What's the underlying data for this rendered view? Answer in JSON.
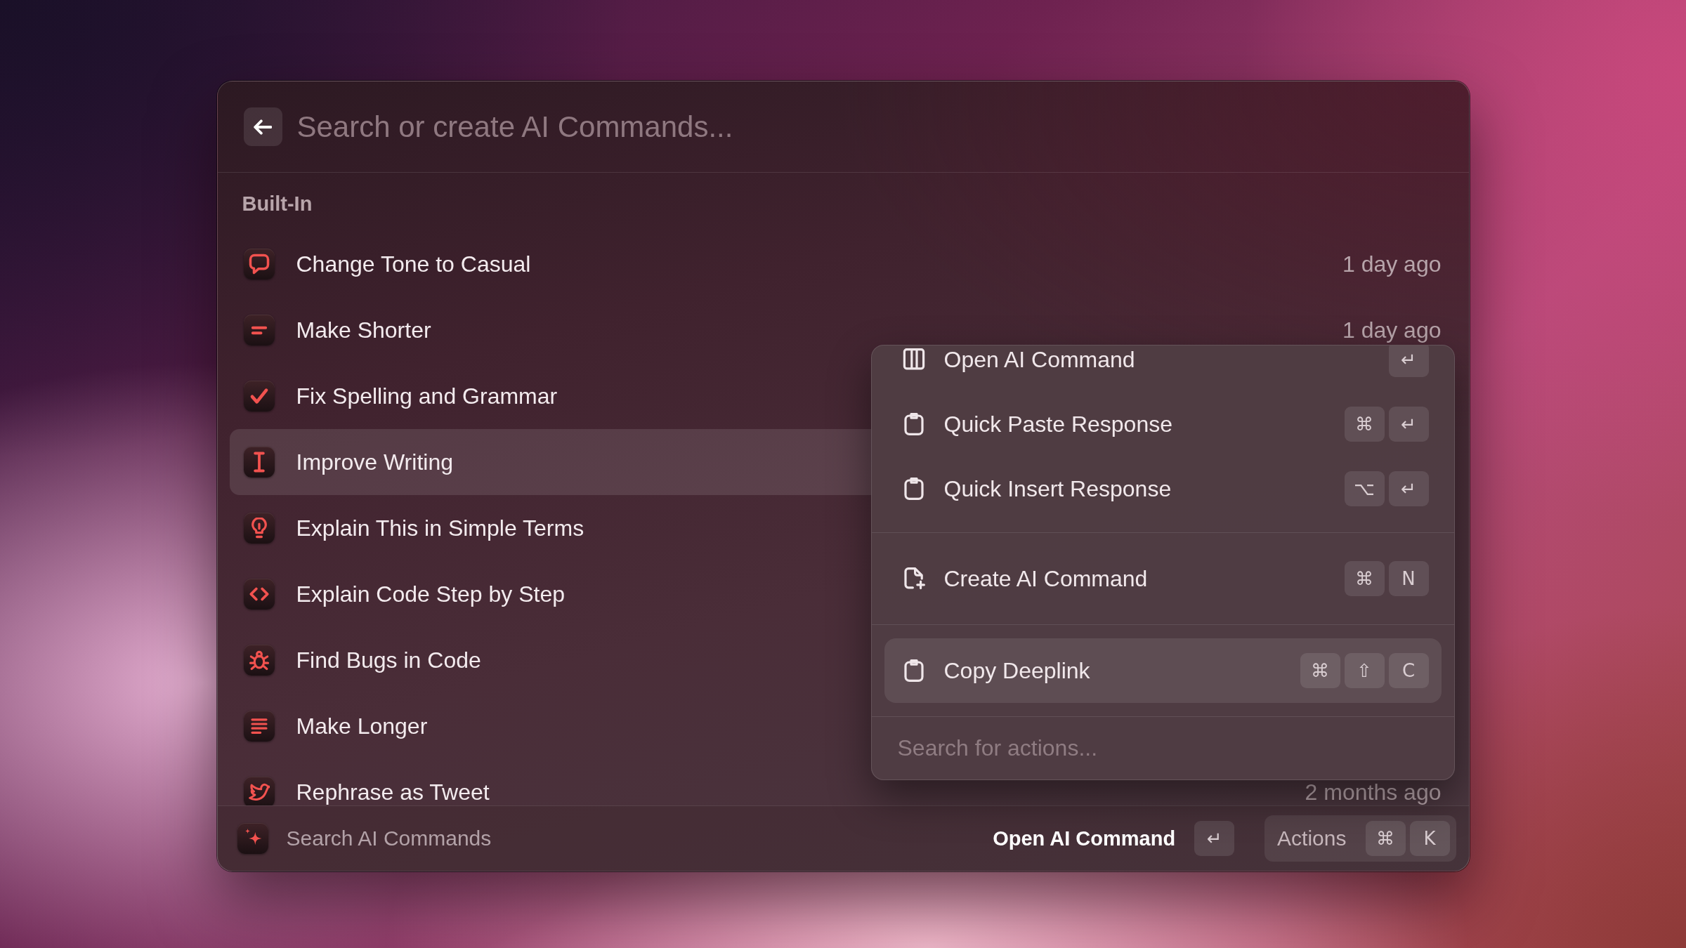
{
  "search": {
    "placeholder": "Search or create AI Commands..."
  },
  "section": {
    "title": "Built-In"
  },
  "commands": [
    {
      "label": "Change Tone to Casual",
      "time": "1 day ago",
      "selected": false
    },
    {
      "label": "Make Shorter",
      "time": "1 day ago",
      "selected": false
    },
    {
      "label": "Fix Spelling and Grammar",
      "selected": false
    },
    {
      "label": "Improve Writing",
      "selected": true
    },
    {
      "label": "Explain This in Simple Terms",
      "selected": false
    },
    {
      "label": "Explain Code Step by Step",
      "selected": false
    },
    {
      "label": "Find Bugs in Code",
      "selected": false
    },
    {
      "label": "Make Longer",
      "selected": false
    },
    {
      "label": "Rephrase as Tweet",
      "time": "2 months ago",
      "selected": false
    }
  ],
  "actions_panel": {
    "groups": [
      {
        "items": [
          {
            "label": "Open AI Command",
            "keys": [
              "↵"
            ],
            "selected": false
          },
          {
            "label": "Quick Paste Response",
            "keys": [
              "⌘",
              "↵"
            ],
            "selected": false
          },
          {
            "label": "Quick Insert Response",
            "keys": [
              "⌥",
              "↵"
            ],
            "selected": false
          }
        ]
      },
      {
        "items": [
          {
            "label": "Create AI Command",
            "keys": [
              "⌘",
              "N"
            ],
            "selected": false
          }
        ]
      },
      {
        "items": [
          {
            "label": "Copy Deeplink",
            "keys": [
              "⌘",
              "⇧",
              "C"
            ],
            "selected": true
          }
        ]
      }
    ],
    "search": {
      "placeholder": "Search for actions..."
    }
  },
  "footer": {
    "title": "Search AI Commands",
    "primary_action": {
      "label": "Open AI Command",
      "keys": [
        "↵"
      ]
    },
    "actions_button": {
      "label": "Actions",
      "keys": [
        "⌘",
        "K"
      ]
    }
  }
}
